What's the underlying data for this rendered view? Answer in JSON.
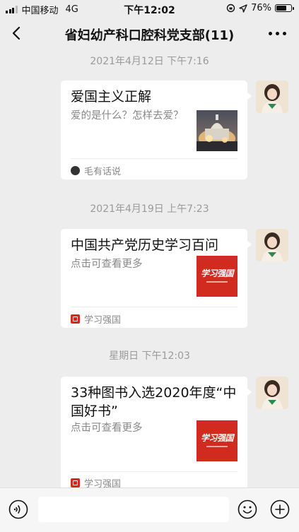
{
  "status_bar": {
    "carrier": "中国移动",
    "network": "4G",
    "time": "下午12:02",
    "battery_text": "76%",
    "battery_level": 0.76
  },
  "nav": {
    "title": "省妇幼产科口腔科党支部(11)",
    "back_icon": "chevron-left-icon",
    "more_icon": "more-dots-icon"
  },
  "messages": [
    {
      "timestamp": "2021年4月12日 下午7:16",
      "title": "爱国主义正解",
      "desc": "爱的是什么？怎样去爱？",
      "source": "毛有话说",
      "thumb": "capitol-building-fire-image"
    },
    {
      "timestamp": "2021年4月19日 上午7:23",
      "title": "中国共产党历史学习百问",
      "desc": "点击可查看更多",
      "source": "学习强国",
      "thumb": "xuexiqiangguo-logo",
      "thumb_text": "学习强国"
    },
    {
      "timestamp": "星期日 下午12:03",
      "title": "33种图书入选2020年度“中国好书”",
      "desc": "点击可查看更多",
      "source": "学习强国",
      "thumb": "xuexiqiangguo-logo",
      "thumb_text": "学习强国"
    }
  ],
  "bottom_bar": {
    "voice_icon": "voice-icon",
    "emoji_icon": "emoji-icon",
    "plus_icon": "plus-icon"
  },
  "colors": {
    "background": "#ededed",
    "xuexi_red": "#d12a1e"
  }
}
